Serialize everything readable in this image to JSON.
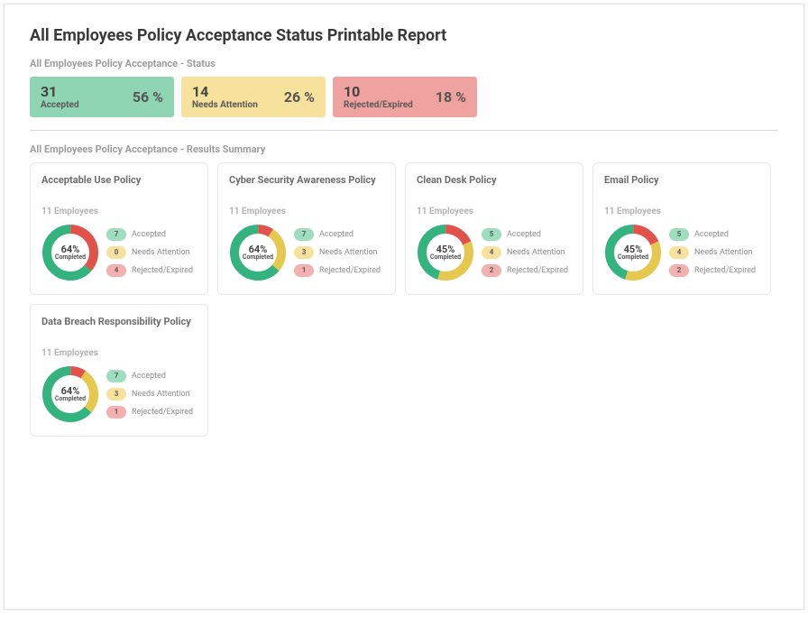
{
  "title": "All Employees Policy Acceptance Status Printable Report",
  "status_label": "All Employees Policy Acceptance - Status",
  "summary_label": "All Employees Policy Acceptance - Results Summary",
  "colors": {
    "green": "#35b37e",
    "yellow": "#e6c84f",
    "red": "#e1534a"
  },
  "status": [
    {
      "count": "31",
      "label": "Accepted",
      "pct": "56 %",
      "class": "green"
    },
    {
      "count": "14",
      "label": "Needs Attention",
      "pct": "26 %",
      "class": "yellow"
    },
    {
      "count": "10",
      "label": "Rejected/Expired",
      "pct": "18 %",
      "class": "red"
    }
  ],
  "completed_label": "Completed",
  "legend_labels": {
    "accepted": "Accepted",
    "attention": "Needs Attention",
    "rejected": "Rejected/Expired"
  },
  "policies": [
    {
      "title": "Acceptable Use Policy",
      "sub": "11 Employees",
      "center_pct": "64%",
      "accepted": 7,
      "attention": 0,
      "rejected": 4
    },
    {
      "title": "Cyber Security Awareness Policy",
      "sub": "11 Employees",
      "center_pct": "64%",
      "accepted": 7,
      "attention": 3,
      "rejected": 1
    },
    {
      "title": "Clean Desk Policy",
      "sub": "11 Employees",
      "center_pct": "45%",
      "accepted": 5,
      "attention": 4,
      "rejected": 2
    },
    {
      "title": "Email Policy",
      "sub": "11 Employees",
      "center_pct": "45%",
      "accepted": 5,
      "attention": 4,
      "rejected": 2
    },
    {
      "title": "Data Breach Responsibility Policy",
      "sub": "11 Employees",
      "center_pct": "64%",
      "accepted": 7,
      "attention": 3,
      "rejected": 1
    }
  ],
  "chart_data": {
    "type": "pie",
    "title": "All Employees Policy Acceptance Status Printable Report",
    "overall": {
      "categories": [
        "Accepted",
        "Needs Attention",
        "Rejected/Expired"
      ],
      "values": [
        31,
        14,
        10
      ],
      "percentages": [
        56,
        26,
        18
      ]
    },
    "series": [
      {
        "name": "Acceptable Use Policy",
        "categories": [
          "Accepted",
          "Needs Attention",
          "Rejected/Expired"
        ],
        "values": [
          7,
          0,
          4
        ],
        "completed_pct": 64,
        "n": 11
      },
      {
        "name": "Cyber Security Awareness Policy",
        "categories": [
          "Accepted",
          "Needs Attention",
          "Rejected/Expired"
        ],
        "values": [
          7,
          3,
          1
        ],
        "completed_pct": 64,
        "n": 11
      },
      {
        "name": "Clean Desk Policy",
        "categories": [
          "Accepted",
          "Needs Attention",
          "Rejected/Expired"
        ],
        "values": [
          5,
          4,
          2
        ],
        "completed_pct": 45,
        "n": 11
      },
      {
        "name": "Email Policy",
        "categories": [
          "Accepted",
          "Needs Attention",
          "Rejected/Expired"
        ],
        "values": [
          5,
          4,
          2
        ],
        "completed_pct": 45,
        "n": 11
      },
      {
        "name": "Data Breach Responsibility Policy",
        "categories": [
          "Accepted",
          "Needs Attention",
          "Rejected/Expired"
        ],
        "values": [
          7,
          3,
          1
        ],
        "completed_pct": 64,
        "n": 11
      }
    ]
  }
}
